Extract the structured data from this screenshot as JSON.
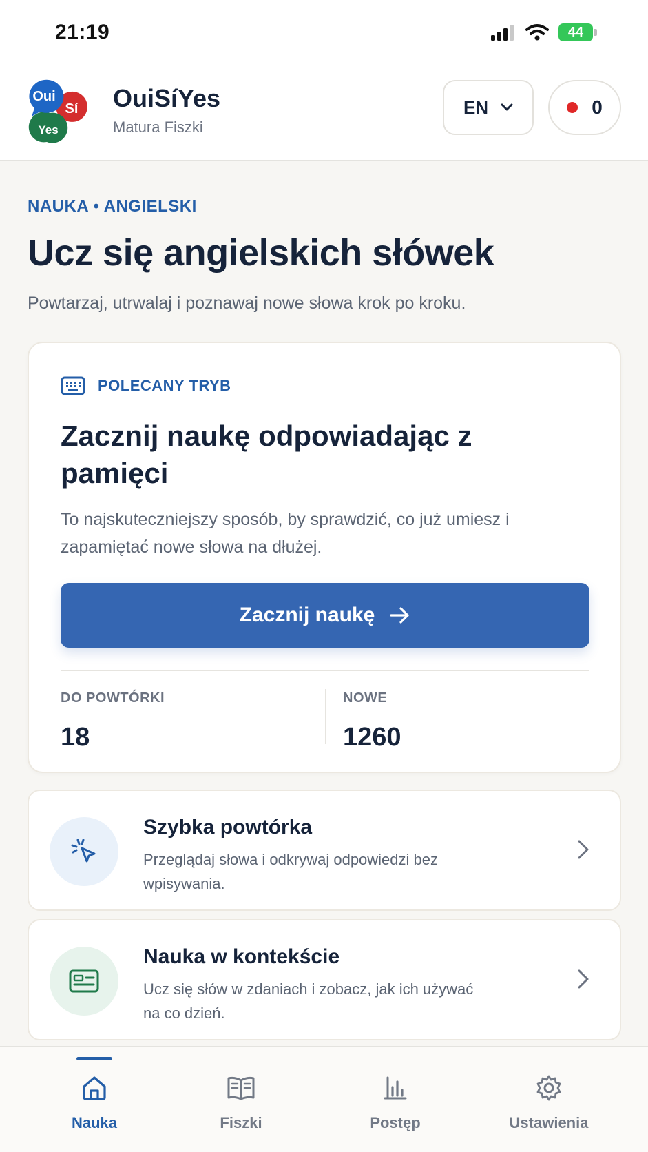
{
  "status_bar": {
    "time": "21:19",
    "battery": "44"
  },
  "header": {
    "logo": {
      "bubble1": "Oui",
      "bubble2": "Sí",
      "bubble3": "Yes"
    },
    "title": "OuiSíYes",
    "subtitle": "Matura Fiszki",
    "language": "EN",
    "streak_count": "0"
  },
  "main": {
    "eyebrow": "NAUKA • ANGIELSKI",
    "title": "Ucz się angielskich słówek",
    "subtitle": "Powtarzaj, utrwalaj i poznawaj nowe słowa krok po kroku.",
    "hero": {
      "tag": "POLECANY TRYB",
      "title": "Zacznij naukę odpowiadając z pamięci",
      "description": "To najskuteczniejszy sposób, by sprawdzić, co już umiesz i zapamiętać nowe słowa na dłużej.",
      "cta_label": "Zacznij naukę",
      "stats": [
        {
          "label": "DO POWTÓRKI",
          "value": "18"
        },
        {
          "label": "NOWE",
          "value": "1260"
        }
      ]
    },
    "modes": [
      {
        "title": "Szybka powtórka",
        "description": "Przeglądaj słowa i odkrywaj odpowiedzi bez wpisywania.",
        "icon": "cursor-click-icon"
      },
      {
        "title": "Nauka w kontekście",
        "description": "Ucz się słów w zdaniach i zobacz, jak ich używać na co dzień.",
        "icon": "text-card-icon"
      }
    ]
  },
  "bottom_nav": {
    "items": [
      {
        "label": "Nauka",
        "icon": "home-icon",
        "active": true
      },
      {
        "label": "Fiszki",
        "icon": "book-icon",
        "active": false
      },
      {
        "label": "Postęp",
        "icon": "bar-chart-icon",
        "active": false
      },
      {
        "label": "Ustawienia",
        "icon": "gear-icon",
        "active": false
      }
    ]
  },
  "colors": {
    "accent": "#245ea8",
    "button": "#3566b2",
    "text": "#16233a",
    "streak_dot": "#e02828"
  }
}
